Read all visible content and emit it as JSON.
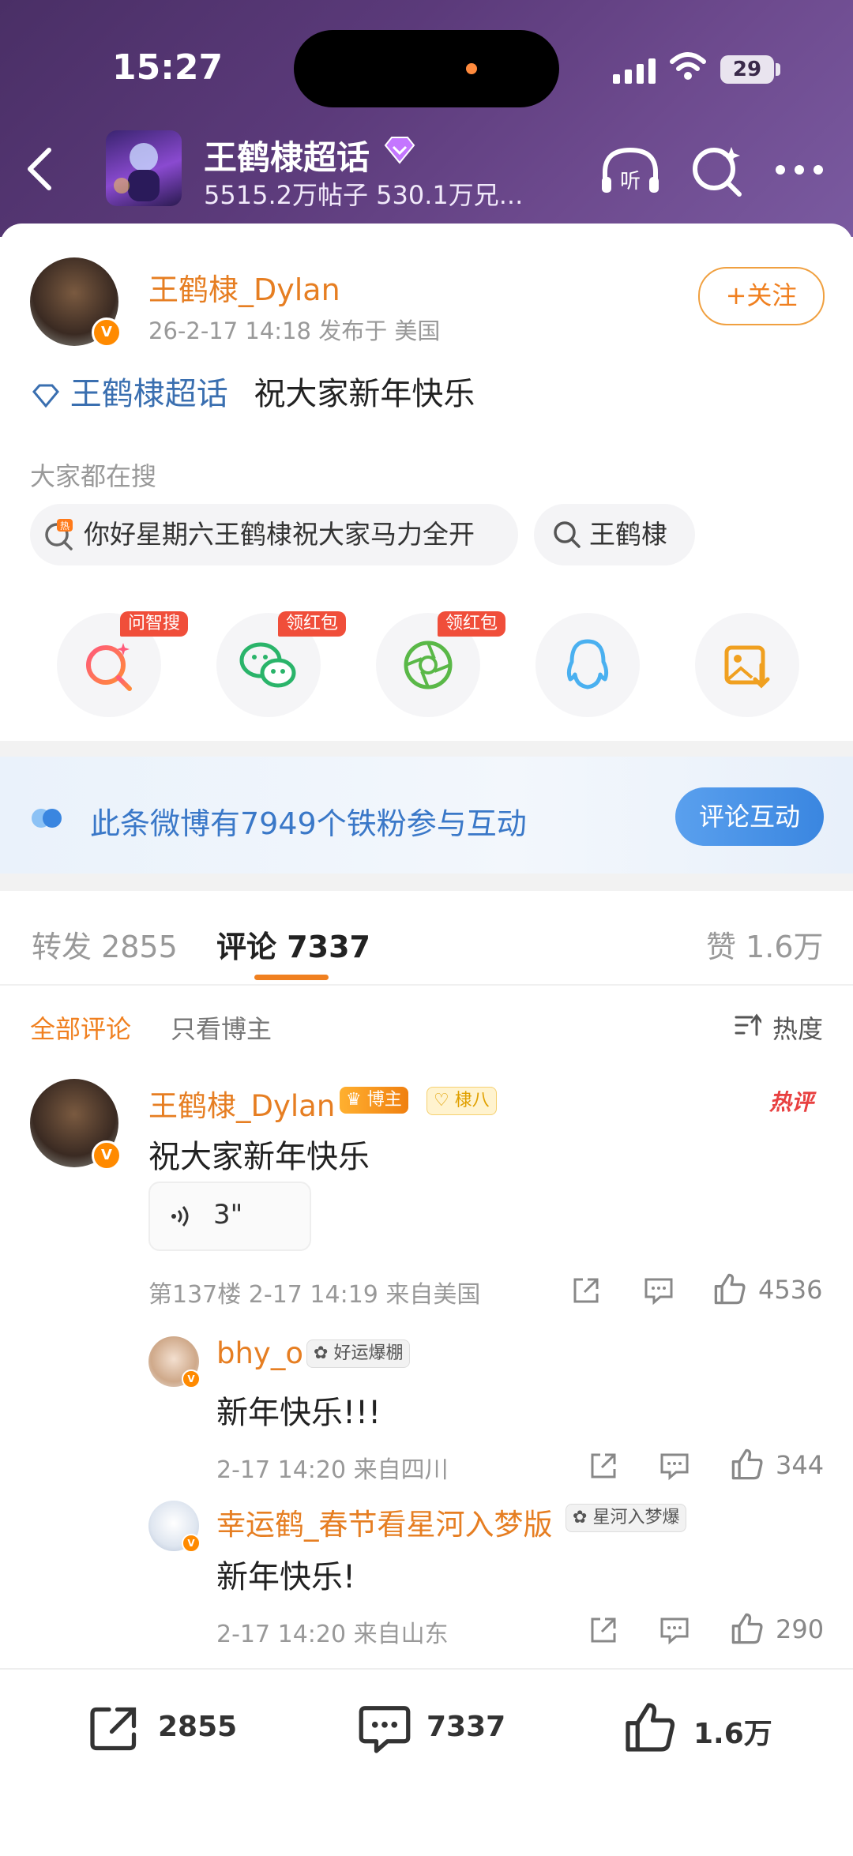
{
  "status": {
    "time": "15:27",
    "battery": "29"
  },
  "header": {
    "title": "王鹤棣超话",
    "subtitle": "5515.2万帖子 530.1万兄..."
  },
  "post": {
    "author": "王鹤棣_Dylan",
    "time_location": "26-2-17 14:18  发布于 美国",
    "follow_label": "+关注",
    "topic": "王鹤棣超话",
    "text": "祝大家新年快乐"
  },
  "search": {
    "label": "大家都在搜",
    "chips": [
      "你好星期六王鹤棣祝大家马力全开",
      "王鹤棣"
    ]
  },
  "share": {
    "tags": [
      "问智搜",
      "领红包",
      "领红包"
    ]
  },
  "fans": {
    "text": "此条微博有7949个铁粉参与互动",
    "button": "评论互动"
  },
  "tabs": {
    "repost": "转发 2855",
    "comment": "评论 7337",
    "like": "赞 1.6万"
  },
  "filters": {
    "all": "全部评论",
    "author_only": "只看博主",
    "sort": "热度"
  },
  "comments": [
    {
      "name": "王鹤棣_Dylan",
      "badge1": "博主",
      "badge2": "棣八",
      "hot": "热评",
      "text": "祝大家新年快乐",
      "voice": "3\"",
      "meta": "第137楼  2-17 14:19  来自美国",
      "likes": "4536"
    },
    {
      "name": "bhy_o",
      "badge": "好运爆棚",
      "text": "新年快乐!!!",
      "meta": "2-17 14:20  来自四川",
      "likes": "344"
    },
    {
      "name": "幸运鹤_春节看星河入梦版",
      "badge": "星河入梦爆",
      "text": "新年快乐!",
      "meta": "2-17 14:20  来自山东",
      "likes": "290"
    }
  ],
  "bottom": {
    "repost": "2855",
    "comment": "7337",
    "like": "1.6万"
  },
  "colors": {
    "accent": "#e67e22",
    "link": "#3a6fb0",
    "header": "#5b3a7a"
  }
}
